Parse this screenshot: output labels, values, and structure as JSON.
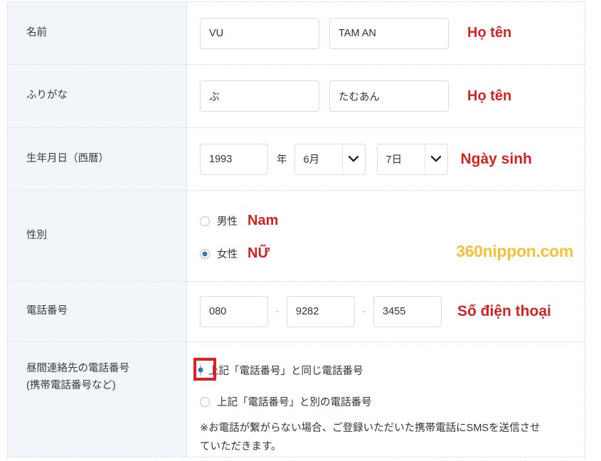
{
  "rows": {
    "name": {
      "label": "名前",
      "first_value": "VU",
      "last_value": "TAM AN",
      "annotation": "Họ tên"
    },
    "furigana": {
      "label": "ふりがな",
      "first_value": "ぶ",
      "last_value": "たむあん",
      "annotation": "Họ tên"
    },
    "birth": {
      "label": "生年月日（西暦）",
      "year_value": "1993",
      "year_unit": "年",
      "month_value": "6月",
      "day_value": "7日",
      "annotation": "Ngày sinh"
    },
    "gender": {
      "label": "性別",
      "male_label": "男性",
      "male_annotation": "Nam",
      "female_label": "女性",
      "female_annotation": "NỮ",
      "selected": "female",
      "watermark": "360nippon.com"
    },
    "tel": {
      "label": "電話番号",
      "part1": "080",
      "part2": "9282",
      "part3": "3455",
      "separator": "-",
      "annotation": "Số điện thoại"
    },
    "daytime": {
      "label_line1": "昼間連絡先の電話番号",
      "label_line2": "(携帯電話番号など)",
      "option_same": "上記「電話番号」と同じ電話番号",
      "option_other": "上記「電話番号」と別の電話番号",
      "selected": "same",
      "note_line1": "※お電話が繋がらない場合、ご登録いただいた携帯電話にSMSを送信させ",
      "note_line2": "ていただきます。"
    }
  },
  "colors": {
    "annotation_red": "#d42222",
    "highlight_red": "#e02020",
    "watermark_gold": "#f5c13c",
    "radio_blue": "#2a7ab9",
    "label_cell_bg": "#f2f6fb",
    "border": "#c9d4e0"
  },
  "icons": {
    "chevron_down": "chevron-down-icon"
  }
}
